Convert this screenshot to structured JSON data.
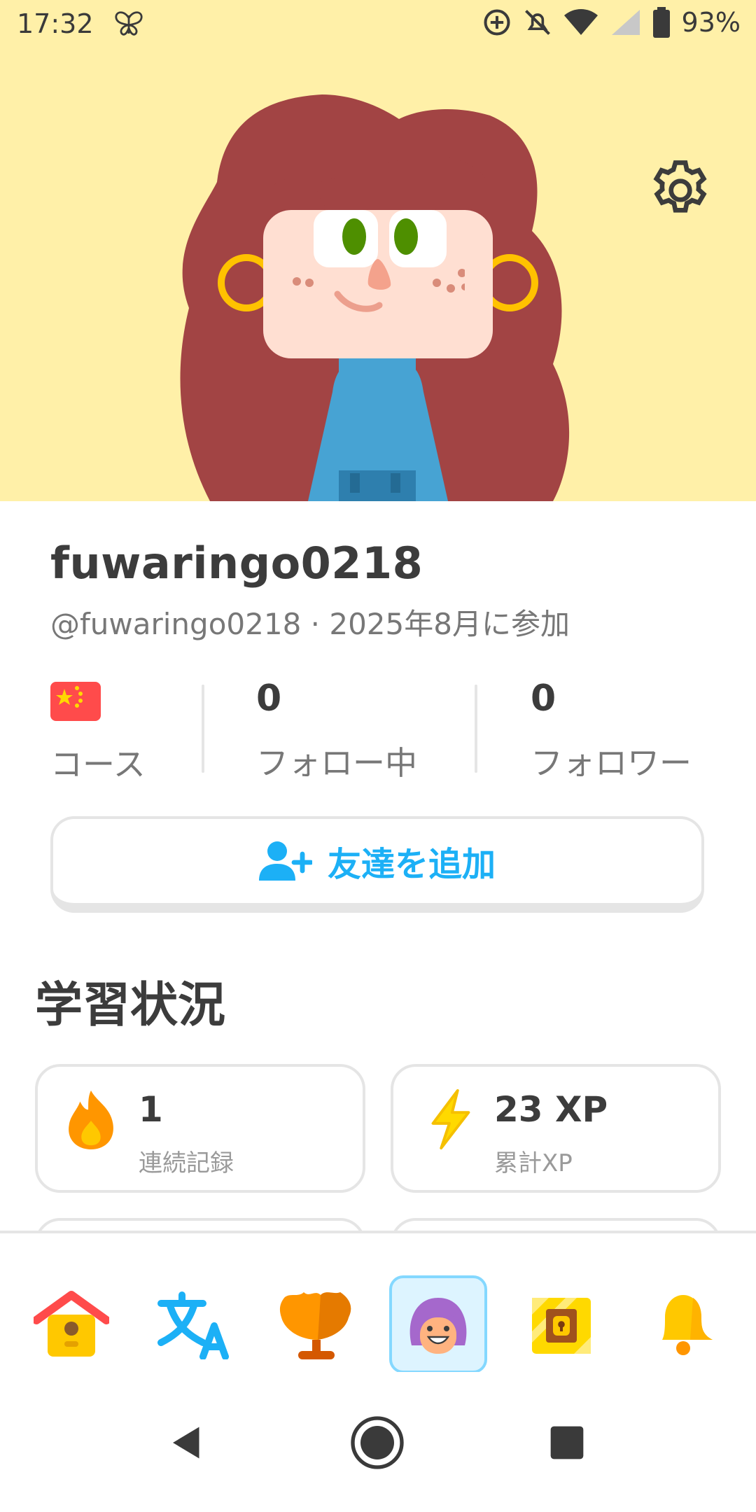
{
  "status_bar": {
    "time": "17:32",
    "battery": "93%",
    "icons": [
      "butterfly-icon",
      "sync-icon",
      "mute-icon",
      "wifi-icon",
      "signal-icon",
      "battery-icon"
    ]
  },
  "profile": {
    "username": "fuwaringo0218",
    "handle_line": "@fuwaringo0218 · 2025年8月に参加",
    "avatar_bg": "#fff0a8",
    "hair_color": "#a24444",
    "sweater_color": "#47a3d3"
  },
  "stats": {
    "course_label": "コース",
    "course_flag": "cn-flag-icon",
    "following_value": "0",
    "following_label": "フォロー中",
    "followers_value": "0",
    "followers_label": "フォロワー"
  },
  "add_friend": {
    "label": "友達を追加",
    "color": "#1cb0f6"
  },
  "learning": {
    "title": "学習状況",
    "cards": [
      {
        "value": "1",
        "label": "連続記録",
        "icon": "fire-icon"
      },
      {
        "value": "23 XP",
        "label": "累計XP",
        "icon": "lightning-icon"
      }
    ]
  },
  "bottom_nav": {
    "items": [
      "home-icon",
      "translate-icon",
      "league-icon",
      "profile-icon",
      "chest-icon",
      "bell-icon"
    ],
    "active": "profile-icon"
  },
  "system_nav": {
    "buttons": [
      "back-icon",
      "home-circle-icon",
      "recents-icon"
    ]
  }
}
